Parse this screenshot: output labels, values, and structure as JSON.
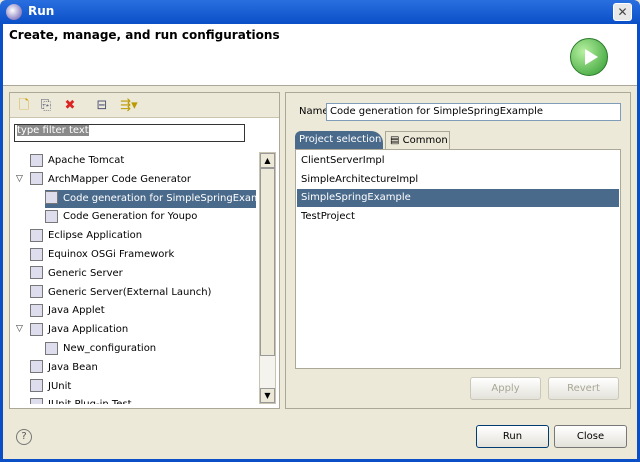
{
  "window": {
    "title": "Run",
    "close": "✕"
  },
  "header": {
    "title": "Create, manage, and run configurations"
  },
  "left": {
    "filter_placeholder": "type filter text",
    "tree": [
      {
        "label": "Apache Tomcat",
        "level": 0
      },
      {
        "label": "ArchMapper Code Generator",
        "level": 0,
        "expanded": true
      },
      {
        "label": "Code generation for SimpleSpringExample",
        "level": 1,
        "selected": true
      },
      {
        "label": "Code Generation for Youpo",
        "level": 1
      },
      {
        "label": "Eclipse Application",
        "level": 0
      },
      {
        "label": "Equinox OSGi Framework",
        "level": 0
      },
      {
        "label": "Generic Server",
        "level": 0
      },
      {
        "label": "Generic Server(External Launch)",
        "level": 0
      },
      {
        "label": "Java Applet",
        "level": 0
      },
      {
        "label": "Java Application",
        "level": 0,
        "expanded": true
      },
      {
        "label": "New_configuration",
        "level": 1
      },
      {
        "label": "Java Bean",
        "level": 0
      },
      {
        "label": "JUnit",
        "level": 0
      },
      {
        "label": "JUnit Plug-in Test",
        "level": 0
      }
    ]
  },
  "right": {
    "name_label": "Name:",
    "name_value": "Code generation for SimpleSpringExample",
    "tabs": [
      "Project selection",
      "Common"
    ],
    "projects": [
      "ClientServerImpl",
      "SimpleArchitectureImpl",
      "SimpleSpringExample",
      "TestProject"
    ],
    "selected_project": "SimpleSpringExample",
    "apply": "Apply",
    "revert": "Revert"
  },
  "footer": {
    "help": "?",
    "run": "Run",
    "close": "Close"
  }
}
